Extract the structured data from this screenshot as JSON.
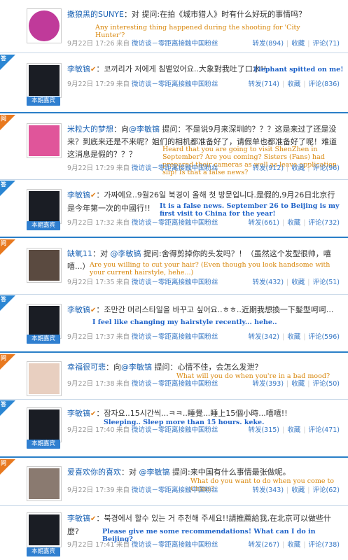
{
  "labels": {
    "q": "问",
    "a": "答",
    "via": "来自",
    "repost": "转发",
    "fav": "收藏",
    "comment": "评论",
    "pipe": "|"
  },
  "source": "微访谈－零距离接触中国粉丝",
  "answerer": {
    "name": "李敏镐",
    "badge": "本期嘉宾"
  },
  "colors": {
    "link": "#1a62b4",
    "q_corner": "#e8791f",
    "a_corner": "#2b86d3",
    "trans_orange": "#d8870c",
    "trans_blue": "#1e62c8"
  },
  "posts": [
    {
      "kind": "q",
      "user": "撒狼黑的SUNYE",
      "before": "：对 ",
      "mention": "",
      "body": "提问:在拍《城市猎人》时有什么好玩的事情吗？",
      "trans": "Any interesting thing happened during the shooting for 'City Hunter'?",
      "date": "9月22日 17:26",
      "repost": "(894)",
      "comment": "(71)"
    },
    {
      "kind": "a",
      "body": "코끼리가 저에게 침뱉었어요..大象對我吐了口水!!",
      "trans": "Elephant spitted on me!",
      "date": "9月22日 17:29",
      "repost": "(714)",
      "comment": "(836)"
    },
    {
      "kind": "q",
      "user": "米粒大的梦想",
      "before": "：向",
      "mention": "@李敏镐",
      "body": " 提问：不是说9月来深圳的？？？这是来过了还是没来？到底来还是不来呢？姐们的相机都准备好了，请假单也都准备好了呢！难道这消息是假的？？？",
      "trans": "Heard that you are going to visit ShenZhen in September? Are you coming? Sisters (Fans) had prepared their cameras as well as leave application slip! Is that a false news?",
      "date": "9月22日 17:29",
      "repost": "(912)",
      "comment": "(96)"
    },
    {
      "kind": "a",
      "body": "가짜예요..9월26일 북경이 올해 첫 방문입니다.是假的,9月26日北京行是今年第一次的中國行!!",
      "trans": "It is a false news. September 26 to Beijing is my first visit to China for the year!",
      "date": "9月22日 17:32",
      "repost": "(661)",
      "comment": "(732)"
    },
    {
      "kind": "q",
      "user": "缺氧11",
      "before": "：对 ",
      "mention": "@李敏镐",
      "body": " 提问:舍得剪掉你的头发吗？！（虽然这个发型很帅，嘻嘻...）",
      "trans": "Are you willing to cut your hair? (Even though you look handsome with your current hairstyle, hehe...)",
      "date": "9月22日 17:35",
      "repost": "(432)",
      "comment": "(51)"
    },
    {
      "kind": "a",
      "body": "조만간 머리스타일을 바꾸고 싶어요..ㅎㅎ..近期我想換一下髮型呵呵...",
      "trans": "I feel like changing my hairstyle recently... hehe..",
      "date": "9月22日 17:37",
      "repost": "(342)",
      "comment": "(596)"
    },
    {
      "kind": "q",
      "user": "幸福很可悲",
      "before": "：向",
      "mention": "@李敏镐",
      "body": " 提问：心情不佳，会怎么发泄？",
      "trans": "What will you do when you're in a bad mood?",
      "date": "9月22日 17:38",
      "repost": "(393)",
      "comment": "(50)"
    },
    {
      "kind": "a",
      "body": "잠자요..15시간씩...ㅋㅋ..睡覺...睡上15個小時...嘻嘻!!",
      "trans": "Sleeping.. Sleep more than 15 hours. keke.",
      "date": "9月22日 17:40",
      "repost": "(315)",
      "comment": "(471)"
    },
    {
      "kind": "q",
      "user": "爱喜欢你的喜欢",
      "before": "：对 ",
      "mention": "@李敏镐",
      "body": " 提问:来中国有什么事情最张做呢。",
      "trans": "What do you want to do when you come to China?",
      "date": "9月22日 17:39",
      "repost": "(343)",
      "comment": "(62)"
    },
    {
      "kind": "a",
      "body": "북경에서 할수 있는 거 추천해 주세요!!請推薦給我,在北京可以做些什麼?",
      "trans": "Please give me some recommendations! What can I do in Beijing?",
      "date": "9月22日 17:41",
      "repost": "(267)",
      "comment": "(738)"
    }
  ]
}
